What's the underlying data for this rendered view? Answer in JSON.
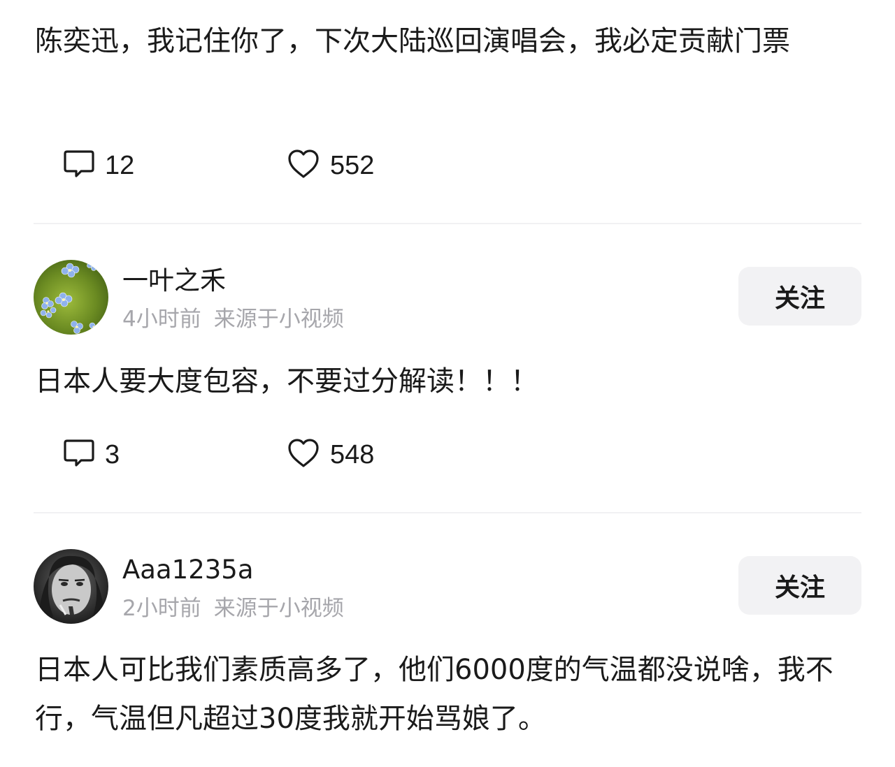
{
  "comments": [
    {
      "text": "陈奕迅，我记住你了，下次大陆巡回演唱会，我必定贡献门票",
      "reply_count": "12",
      "like_count": "552"
    },
    {
      "username": "一叶之禾",
      "time": "4小时前",
      "source": "来源于小视频",
      "follow_label": "关注",
      "avatar_icon": "forget-me-not-flowers",
      "text": "日本人要大度包容，不要过分解读！！！",
      "reply_count": "3",
      "like_count": "548"
    },
    {
      "username": "Aaa1235a",
      "time": "2小时前",
      "source": "来源于小视频",
      "follow_label": "关注",
      "avatar_icon": "bw-portrait",
      "text": "日本人可比我们素质高多了，他们6000度的气温都没说啥，我不行，气温但凡超过30度我就开始骂娘了。"
    }
  ],
  "colors": {
    "text": "#1a1a1a",
    "meta": "#a6a6ab",
    "button_bg": "#f2f2f4",
    "divider": "#f1f1f3"
  }
}
